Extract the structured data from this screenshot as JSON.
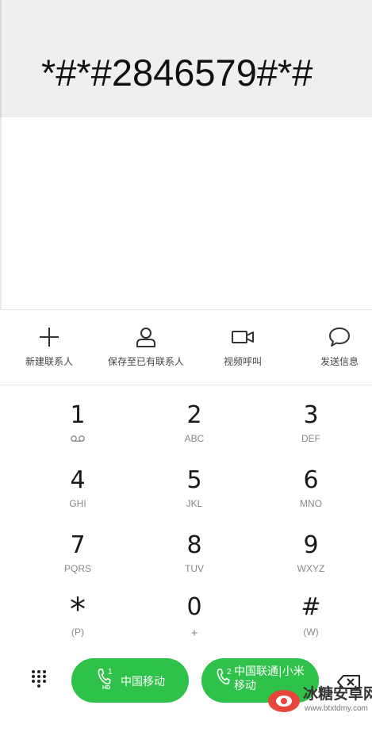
{
  "display": {
    "number": "*#*#2846579#*#"
  },
  "actions": [
    {
      "label": "新建联系人",
      "icon": "plus-icon"
    },
    {
      "label": "保存至已有联系人",
      "icon": "person-icon"
    },
    {
      "label": "视频呼叫",
      "icon": "video-camera-icon"
    },
    {
      "label": "发送信息",
      "icon": "message-bubble-icon"
    }
  ],
  "keypad": {
    "keys": [
      {
        "digit": "1",
        "sub": "voicemail-icon"
      },
      {
        "digit": "2",
        "sub": "ABC"
      },
      {
        "digit": "3",
        "sub": "DEF"
      },
      {
        "digit": "4",
        "sub": "GHI"
      },
      {
        "digit": "5",
        "sub": "JKL"
      },
      {
        "digit": "6",
        "sub": "MNO"
      },
      {
        "digit": "7",
        "sub": "PQRS"
      },
      {
        "digit": "8",
        "sub": "TUV"
      },
      {
        "digit": "9",
        "sub": "WXYZ"
      },
      {
        "digit": "*",
        "sub": "(P)"
      },
      {
        "digit": "0",
        "sub": "+"
      },
      {
        "digit": "#",
        "sub": "(W)"
      }
    ]
  },
  "call_buttons": [
    {
      "sim": "1",
      "badge": "HD",
      "label": "中国移动"
    },
    {
      "sim": "2",
      "label": "中国联通|小米移动"
    }
  ],
  "watermark": {
    "title": "冰糖安卓网",
    "url": "www.btxtdmy.com"
  },
  "colors": {
    "call_green": "#2ec24a",
    "display_bg": "#efefef"
  }
}
